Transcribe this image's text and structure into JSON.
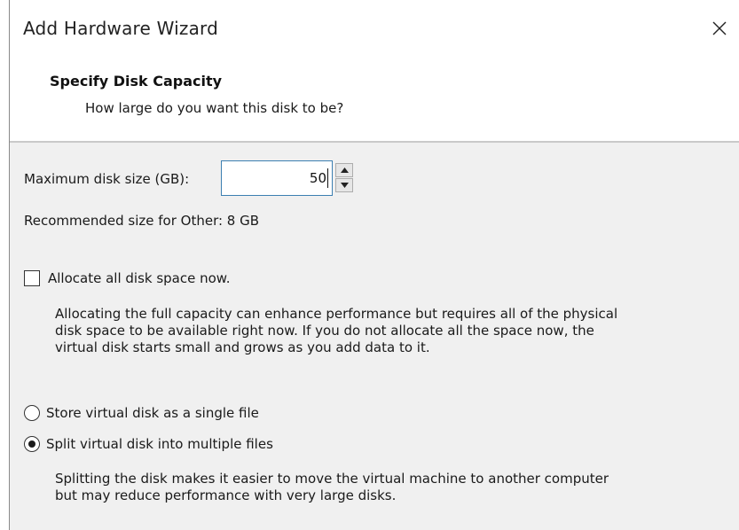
{
  "window": {
    "title": "Add Hardware Wizard"
  },
  "header": {
    "title": "Specify Disk Capacity",
    "subtitle": "How large do you want this disk to be?"
  },
  "disk_size": {
    "label": "Maximum disk size (GB):",
    "value": "50",
    "recommended": "Recommended size for Other: 8 GB"
  },
  "allocate": {
    "checked": false,
    "label": "Allocate all disk space now.",
    "description_lines": [
      "Allocating the full capacity can enhance performance but requires all of the physical",
      "disk space to be available right now. If you do not allocate all the space now, the",
      "virtual disk starts small and grows as you add data to it."
    ]
  },
  "storage_options": {
    "single_file": {
      "label": "Store virtual disk as a single file",
      "selected": false
    },
    "split_files": {
      "label": "Split virtual disk into multiple files",
      "selected": true
    },
    "split_description_lines": [
      "Splitting the disk makes it easier to move the virtual machine to another computer",
      "but may reduce performance with very large disks."
    ]
  },
  "icons": {
    "close": "close-icon",
    "spin_up": "chevron-up-icon",
    "spin_down": "chevron-down-icon"
  },
  "colors": {
    "content_bg": "#f0f0f0",
    "input_border": "#3c7fb1"
  }
}
